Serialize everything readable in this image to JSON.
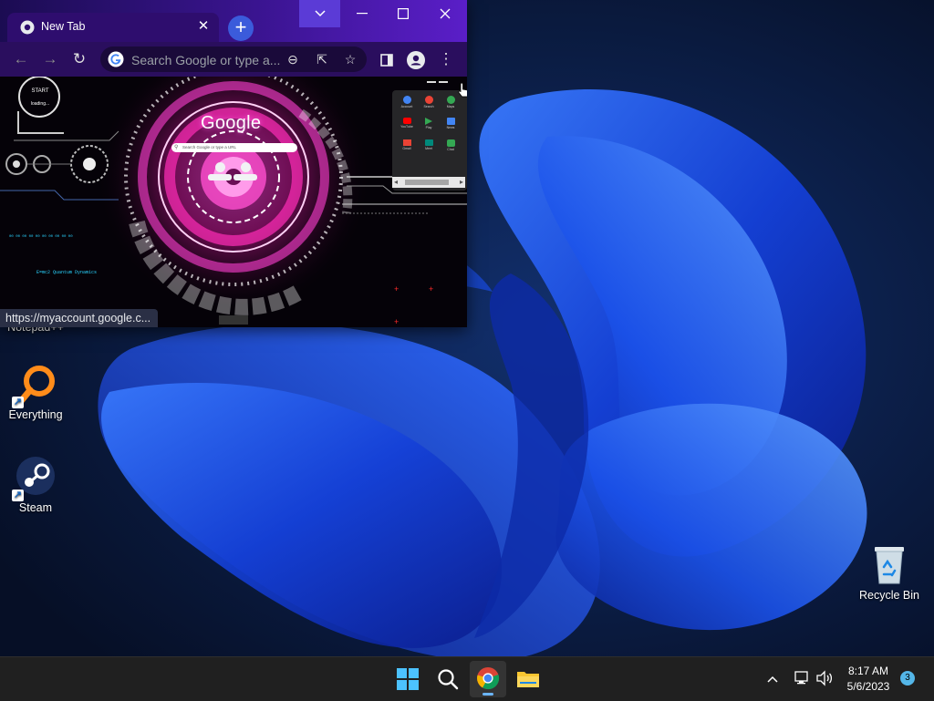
{
  "browser": {
    "tab_title": "New Tab",
    "omnibox_placeholder": "Search Google or type a...",
    "status_url": "https://myaccount.google.c...",
    "ntp": {
      "start_label": "START",
      "loading_label": "loading...",
      "google_logo": "Google",
      "search_placeholder": "Search Google or type a URL",
      "apps": [
        "Account",
        "Search",
        "Maps",
        "YouTube",
        "Play",
        "News",
        "Gmail",
        "Meet",
        "Chat"
      ]
    }
  },
  "desktop": {
    "icons": [
      {
        "label": "Notepad++"
      },
      {
        "label": "Everything"
      },
      {
        "label": "Steam"
      },
      {
        "label": "Recycle Bin"
      }
    ]
  },
  "taskbar": {
    "time": "8:17 AM",
    "date": "5/6/2023",
    "notification_count": "3"
  },
  "colors": {
    "titlebar_accent": "#3a1490",
    "newtab_button": "#3b5bdb",
    "taskbar_bg": "#202020",
    "notification_badge": "#54b6e8"
  }
}
